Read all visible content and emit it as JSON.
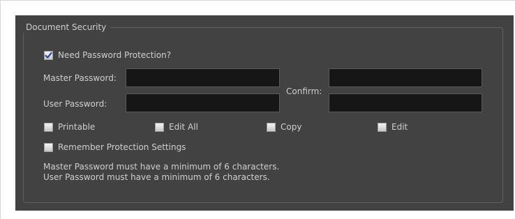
{
  "group": {
    "title": "Document Security"
  },
  "need_password": {
    "label": "Need Password Protection?",
    "checked": true
  },
  "master_password": {
    "label": "Master Password:",
    "value": ""
  },
  "user_password": {
    "label": "User Password:",
    "value": ""
  },
  "confirm": {
    "label": "Confirm:",
    "master_value": "",
    "user_value": ""
  },
  "permissions": [
    {
      "label": "Printable",
      "checked": false
    },
    {
      "label": "Edit All",
      "checked": false
    },
    {
      "label": "Copy",
      "checked": false
    },
    {
      "label": "Edit",
      "checked": false
    }
  ],
  "remember": {
    "label": "Remember Protection Settings",
    "checked": false
  },
  "info": {
    "line1": "Master Password must have a minimum of 6 characters.",
    "line2": "User Password must have a minimum of 6 characters."
  },
  "colors": {
    "panel": "#424242",
    "input_bg": "#161616",
    "check": "#2a4fa0"
  }
}
